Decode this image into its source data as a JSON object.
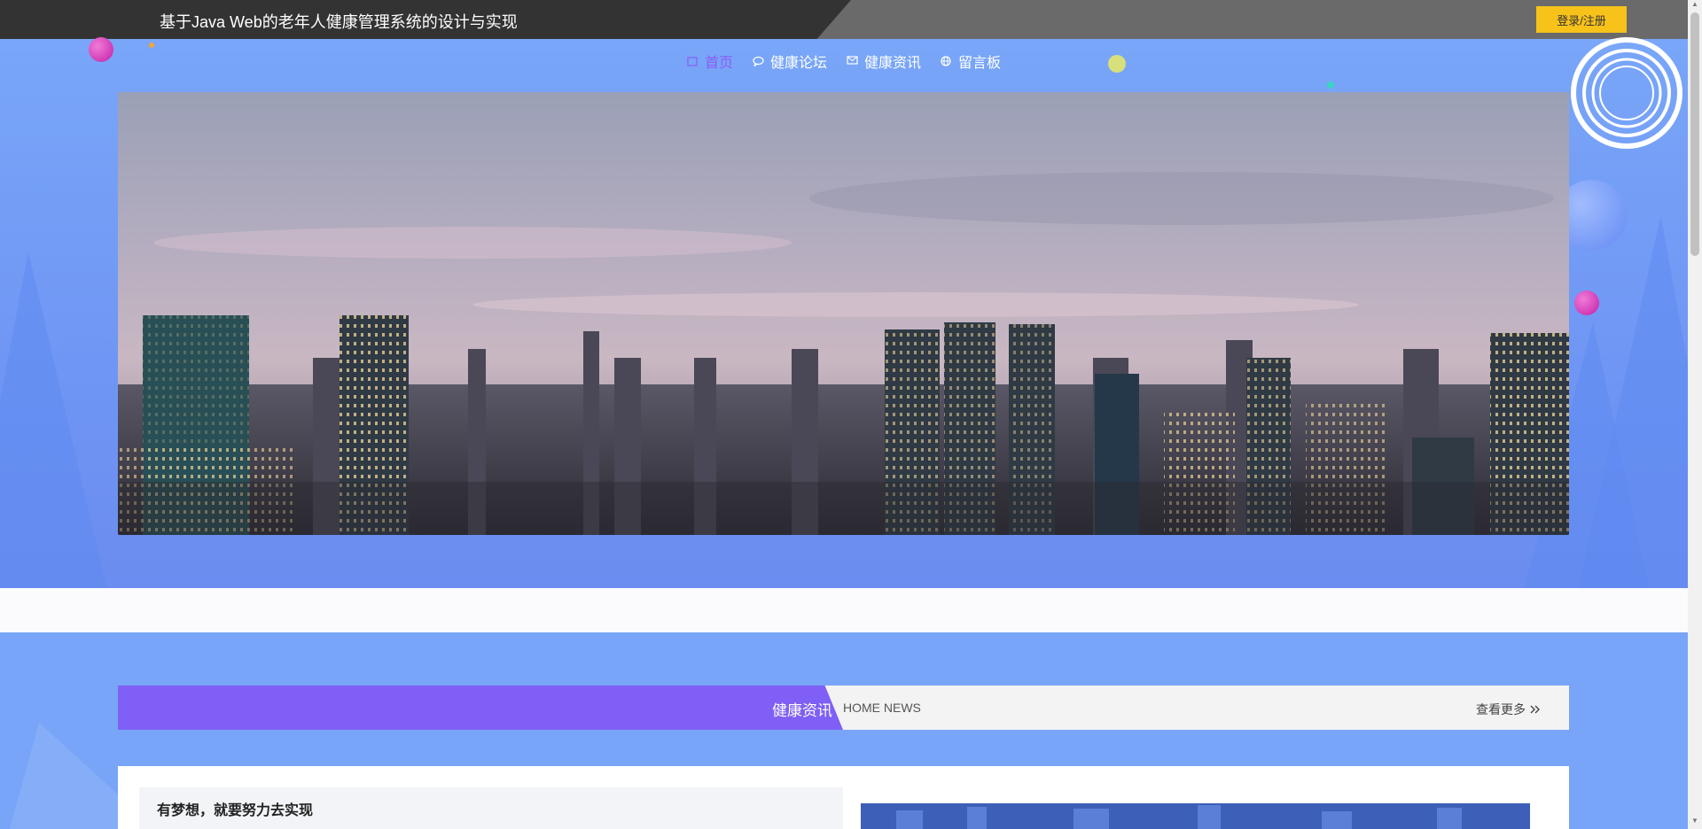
{
  "header": {
    "site_title": "基于Java Web的老年人健康管理系统的设计与实现",
    "login_label": "登录/注册"
  },
  "nav": {
    "items": [
      {
        "label": "首页",
        "icon": "home-icon",
        "active": true
      },
      {
        "label": "健康论坛",
        "icon": "chat-icon",
        "active": false
      },
      {
        "label": "健康资讯",
        "icon": "mail-icon",
        "active": false
      },
      {
        "label": "留言板",
        "icon": "globe-icon",
        "active": false
      }
    ]
  },
  "carousel": {
    "slide_count": 3,
    "active_index": 0
  },
  "news_section": {
    "title": "健康资讯",
    "subtitle": "HOME NEWS",
    "more_label": "查看更多"
  },
  "news_card": {
    "title": "有梦想，就要努力去实现"
  },
  "colors": {
    "accent_purple": "#7f5ff5",
    "login_yellow": "#f7c21a",
    "hero_blue": "#79a6f8",
    "topbar_dark": "#333333"
  }
}
